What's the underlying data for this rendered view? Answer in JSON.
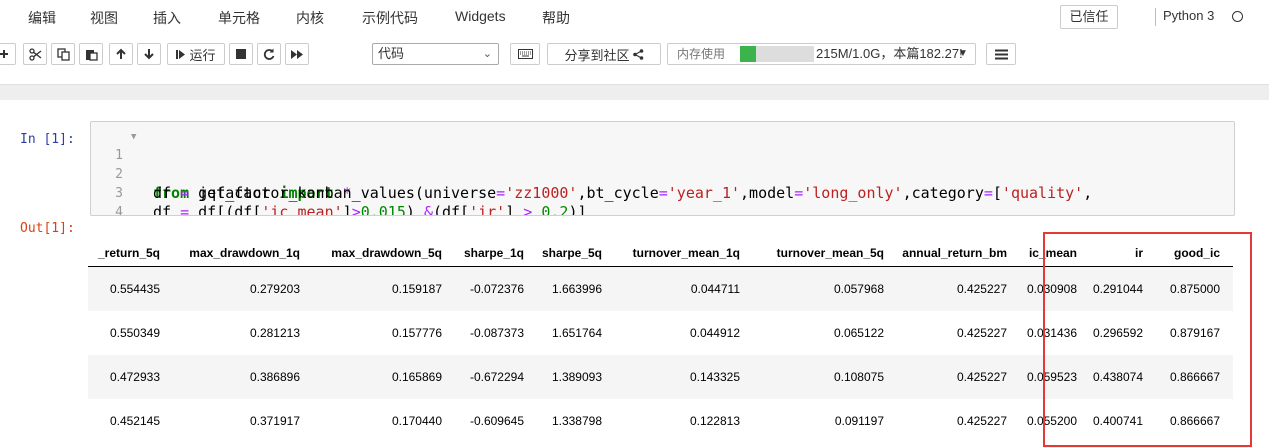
{
  "menu": {
    "items": [
      "编辑",
      "视图",
      "插入",
      "单元格",
      "内核",
      "示例代码",
      "Widgets",
      "帮助"
    ],
    "trusted": "已信任",
    "kernel": "Python 3"
  },
  "toolbar": {
    "run_label": "运行",
    "cell_type": "代码",
    "share_label": "分享到社区",
    "memory_label": "内存使用",
    "memory_text": "215M/1.0G，本篇182.27!",
    "memory_fraction": 0.21
  },
  "cell": {
    "in_prompt": "In [1]:",
    "out_prompt": "Out[1]:",
    "line_numbers": [
      "1",
      "2",
      "3",
      "4"
    ]
  },
  "table": {
    "columns": [
      "_return_5q",
      "max_drawdown_1q",
      "max_drawdown_5q",
      "sharpe_1q",
      "sharpe_5q",
      "turnover_mean_1q",
      "turnover_mean_5q",
      "annual_return_bm",
      "ic_mean",
      "ir",
      "good_ic"
    ],
    "rows": [
      [
        "0.554435",
        "0.279203",
        "0.159187",
        "-0.072376",
        "1.663996",
        "0.044711",
        "0.057968",
        "0.425227",
        "0.030908",
        "0.291044",
        "0.875000"
      ],
      [
        "0.550349",
        "0.281213",
        "0.157776",
        "-0.087373",
        "1.651764",
        "0.044912",
        "0.065122",
        "0.425227",
        "0.031436",
        "0.296592",
        "0.879167"
      ],
      [
        "0.472933",
        "0.386896",
        "0.165869",
        "-0.672294",
        "1.389093",
        "0.143325",
        "0.108075",
        "0.425227",
        "0.059523",
        "0.438074",
        "0.866667"
      ],
      [
        "0.452145",
        "0.371917",
        "0.170440",
        "-0.609645",
        "1.338798",
        "0.122813",
        "0.091197",
        "0.425227",
        "0.055200",
        "0.400741",
        "0.866667"
      ]
    ]
  },
  "colors": {
    "highlight": "#e53935",
    "memory_fill": "#3cb44b",
    "in_prompt": "#303f9f",
    "out_prompt": "#d84315"
  }
}
